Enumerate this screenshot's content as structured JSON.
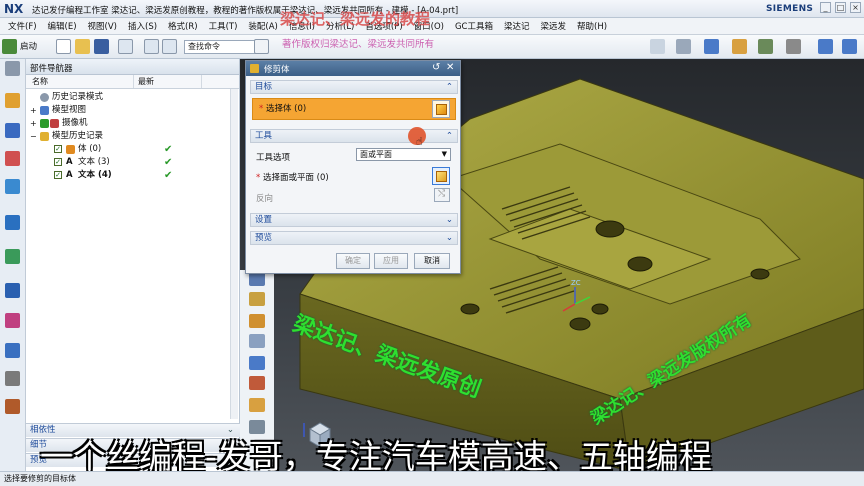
{
  "app": {
    "logo": "NX",
    "title": "达记发仔编程工作室 梁达记、梁远发原创教程，教程的著作版权属于梁达记、梁远发共同所有 - 建模 - [A-04.prt]",
    "brand": "SIEMENS",
    "window_controls": [
      "_",
      "□",
      "×"
    ]
  },
  "menu": [
    "文件(F)",
    "编辑(E)",
    "视图(V)",
    "插入(S)",
    "格式(R)",
    "工具(T)",
    "装配(A)",
    "信息(I)",
    "分析(L)",
    "首选项(P)",
    "窗口(O)",
    "GC工具箱",
    "梁达记",
    "梁远发",
    "帮助(H)"
  ],
  "toolbar": {
    "start_label": "启动",
    "command_search": "查找命令"
  },
  "watermark_top": {
    "line1": "梁达记、梁远发的教程",
    "line2": "著作版权归梁达记、梁远发共同所有"
  },
  "navigator": {
    "title": "部件导航器",
    "col_name": "名称",
    "col_latest": "最新",
    "rows": [
      {
        "label": "历史记录模式",
        "latest": ""
      },
      {
        "label": "模型视图",
        "latest": ""
      },
      {
        "label": "摄像机",
        "latest": ""
      },
      {
        "label": "模型历史记录",
        "latest": ""
      },
      {
        "label": "体 (0)",
        "latest": "✔"
      },
      {
        "label": "文本 (3)",
        "latest": "✔"
      },
      {
        "label": "文本 (4)",
        "latest": "✔"
      }
    ],
    "bottom": [
      "相依性",
      "细节",
      "预览"
    ]
  },
  "dialog": {
    "title": "修剪体",
    "section_target": "目标",
    "select_body": "选择体 (0)",
    "section_tool": "工具",
    "tool_option_label": "工具选项",
    "tool_option_value": "面或平面",
    "select_face": "选择面或平面 (0)",
    "reverse": "反向",
    "section_settings": "设置",
    "section_preview": "预览",
    "btn_ok": "确定",
    "btn_apply": "应用",
    "btn_cancel": "取消"
  },
  "viewport_overlay": {
    "wm1": "梁达记、梁远发原创",
    "wm2": "梁达记、梁远发版权所有",
    "axis_label": "ZC"
  },
  "caption": "一个丝编程-发哥，专注汽车模高速、五轴编程",
  "status": "选择要修剪的目标体",
  "colors": {
    "accent_orange": "#f5a533",
    "watermark_green": "#2fdf2f",
    "model_olive": "#8c8a2a"
  }
}
